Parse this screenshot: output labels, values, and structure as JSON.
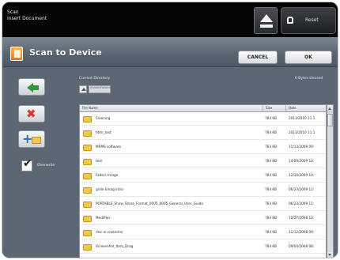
{
  "topbar": {
    "line1": "Scan",
    "line2": "Insert Document",
    "reset_label": "Reset"
  },
  "dialog": {
    "title": "Scan to Device",
    "cancel_label": "CANCEL",
    "ok_label": "OK"
  },
  "sidebar": {
    "overwrite_label": "Overwrite",
    "overwrite_checked": true
  },
  "destination": {
    "label": "Current Directory",
    "path": "\\Folder\\Folder2",
    "free_space": "0 Bytes Unused"
  },
  "table": {
    "columns": [
      "File Name",
      "Size",
      "Date"
    ],
    "rows": [
      {
        "name": "Cleaning",
        "size": "764 KB",
        "date": "2013/2010 11:1"
      },
      {
        "name": "html_test",
        "size": "764 KB",
        "date": "2013/2010 11:1"
      },
      {
        "name": "MRMS software",
        "size": "764 KB",
        "date": "11/13/2009 09:"
      },
      {
        "name": "test",
        "size": "764 KB",
        "date": "14/09/2009 10:"
      },
      {
        "name": "Faders Image",
        "size": "764 KB",
        "date": "12/10/2009 10:"
      },
      {
        "name": "grille Emag intro",
        "size": "764 KB",
        "date": "06/23/2009 12:"
      },
      {
        "name": "PORTABLE_Show_Share_Format_0005_0005_General_User_Guide",
        "size": "764 KB",
        "date": "06/23/2009 11:"
      },
      {
        "name": "Medifiles",
        "size": "764 KB",
        "date": "10/27/2008 10:"
      },
      {
        "name": "disc in container",
        "size": "764 KB",
        "date": "11/12/2008 09:"
      },
      {
        "name": "Screenshot_Item_Drag",
        "size": "764 KB",
        "date": "09/04/2008 08:"
      }
    ]
  },
  "colors": {
    "titlebar": "#5b6672",
    "content_bg": "#5c6773",
    "folder": "#f2c84b",
    "back_arrow": "#2f9a3a",
    "delete": "#d23b2e"
  }
}
